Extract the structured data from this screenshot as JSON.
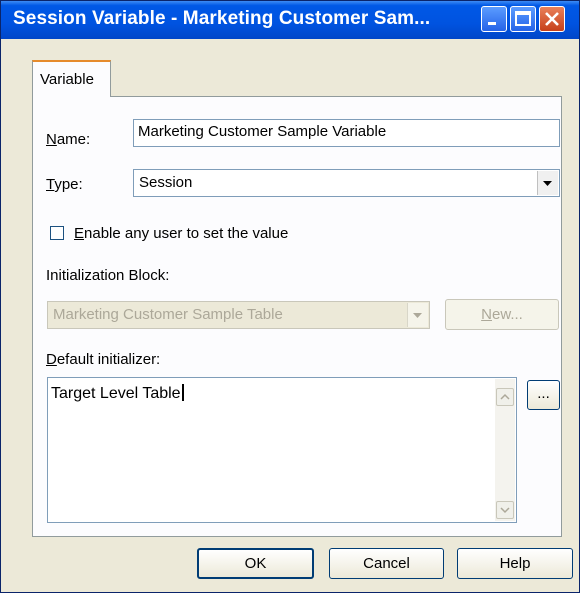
{
  "window": {
    "title": "Session Variable - Marketing Customer Sam...",
    "title_bg": "#0054e3"
  },
  "tabs": [
    {
      "label": "Variable",
      "active": true
    }
  ],
  "form": {
    "name_label_prefix": "N",
    "name_label_rest": "ame:",
    "name_value": "Marketing Customer Sample Variable",
    "type_label_prefix": "T",
    "type_label_rest": "ype:",
    "type_value": "Session",
    "enable_label_prefix": "E",
    "enable_label_rest": "nable any user to set the value",
    "enable_checked": false,
    "init_block_label": "Initialization Block:",
    "init_block_value": "Marketing Customer Sample Table",
    "new_button_prefix": "N",
    "new_button_rest": "ew...",
    "default_label_prefix": "D",
    "default_label_rest": "efault initializer:",
    "default_value": "Target Level Table",
    "ellipsis_button": "..."
  },
  "footer": {
    "ok": "OK",
    "cancel": "Cancel",
    "help": "Help"
  },
  "icons": [
    "minimize-icon",
    "maximize-icon",
    "close-icon",
    "dropdown-arrow-icon",
    "scroll-up-icon",
    "scroll-down-icon"
  ]
}
